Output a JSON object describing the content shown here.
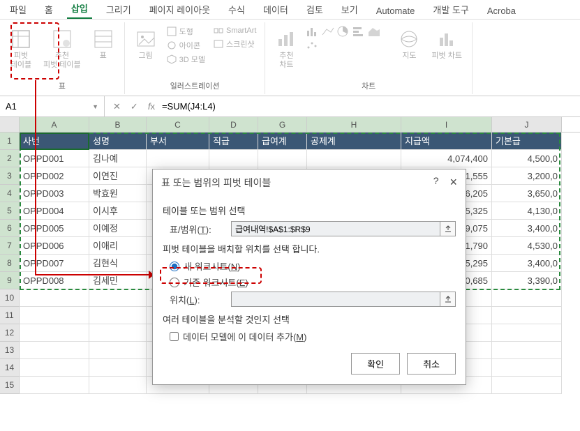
{
  "tabs": [
    "파일",
    "홈",
    "삽입",
    "그리기",
    "페이지 레이아웃",
    "수식",
    "데이터",
    "검토",
    "보기",
    "Automate",
    "개발 도구",
    "Acroba"
  ],
  "active_tab_index": 2,
  "ribbon": {
    "groups": {
      "table": {
        "pivot": "피벗\n테이블",
        "rec": "추천\n피벗 테이블",
        "table": "표",
        "label": "표"
      },
      "illus": {
        "picture": "그림",
        "shapes": "도형",
        "icons": "아이콘",
        "model3d": "3D 모델",
        "smartart": "SmartArt",
        "screenshot": "스크린샷",
        "label": "일러스트레이션"
      },
      "chart": {
        "rec": "추천\n차트",
        "label": "차트",
        "map": "지도",
        "pivotchart": "피벗 차트"
      }
    }
  },
  "namebox": "A1",
  "formula": "=SUM(J4:L4)",
  "columns": [
    "A",
    "B",
    "C",
    "D",
    "G",
    "H",
    "I",
    "J"
  ],
  "headers": {
    "A": "사번",
    "B": "성명",
    "C": "부서",
    "D": "직급",
    "G": "급여계",
    "H": "공제계",
    "I": "지급액",
    "J": "기본급"
  },
  "rows": [
    {
      "A": "OPPD001",
      "B": "김나예",
      "I": "4,074,400",
      "J": "4,500,0"
    },
    {
      "A": "OPPD002",
      "B": "이연진",
      "I": "3,011,555",
      "J": "3,200,0"
    },
    {
      "A": "OPPD003",
      "B": "박효원",
      "I": "3,306,205",
      "J": "3,650,0"
    },
    {
      "A": "OPPD004",
      "B": "이시후",
      "I": "3,605,325",
      "J": "4,130,0"
    },
    {
      "A": "OPPD005",
      "B": "이예정",
      "I": "3,199,075",
      "J": "3,400,0"
    },
    {
      "A": "OPPD006",
      "B": "이애리",
      "I": "3,921,790",
      "J": "4,530,0"
    },
    {
      "A": "OPPD007",
      "B": "김현식",
      "I": "3,835,295",
      "J": "3,400,0"
    },
    {
      "A": "OPPD008",
      "B": "김세민",
      "I": "3,070,685",
      "J": "3,390,0"
    }
  ],
  "dialog": {
    "title": "표 또는 범위의 피벗 테이블",
    "help": "?",
    "close": "×",
    "sec_range": "테이블 또는 범위 선택",
    "range_label": "표/범위(T):",
    "range_value": "급여내역!$A$1:$R$9",
    "sec_location": "피벗 테이블을 배치할 위치를 선택 합니다.",
    "radio_new": "새 워크시트(N)",
    "radio_exist": "기존 워크시트(E)",
    "loc_label": "위치(L):",
    "loc_value": "",
    "sec_multi": "여러 테이블을 분석할 것인지 선택",
    "chk_model": "데이터 모델에 이 데이터 추가(M)",
    "ok": "확인",
    "cancel": "취소"
  }
}
